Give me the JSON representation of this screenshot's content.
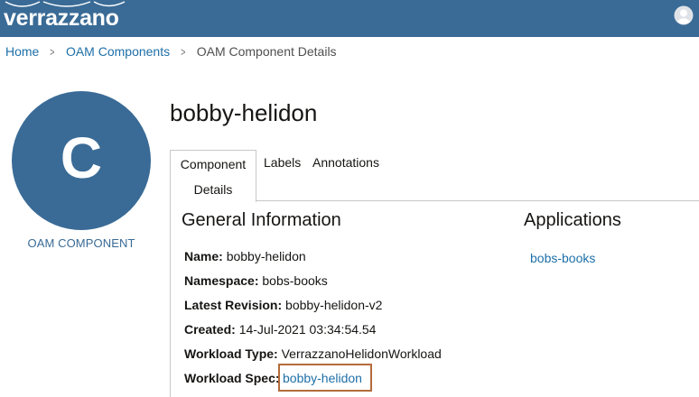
{
  "header": {
    "brand": "verrazzano",
    "brand_color": "#3a6b96",
    "user_icon": "user-avatar-icon"
  },
  "breadcrumb": {
    "items": [
      "Home",
      "OAM Components"
    ],
    "current": "OAM Component Details",
    "separator_icon": "chevron-right-icon"
  },
  "profile": {
    "initial": "C",
    "caption": "OAM COMPONENT"
  },
  "page": {
    "title": "bobby-helidon"
  },
  "tabs": {
    "items": [
      {
        "line1": "Component",
        "line2": "Details"
      },
      {
        "label": "Labels"
      },
      {
        "label": "Annotations"
      }
    ],
    "active_index": 0
  },
  "general_information": {
    "heading": "General Information",
    "fields": [
      {
        "label": "Name:",
        "value": "bobby-helidon"
      },
      {
        "label": "Namespace:",
        "value": "bobs-books"
      },
      {
        "label": "Latest Revision:",
        "value": "bobby-helidon-v2"
      },
      {
        "label": "Created:",
        "value": "14-Jul-2021 03:34:54.54"
      },
      {
        "label": "Workload Type:",
        "value": "VerrazzanoHelidonWorkload"
      },
      {
        "label": "Workload Spec:",
        "value": "bobby-helidon"
      }
    ]
  },
  "applications": {
    "heading": "Applications",
    "items": [
      "bobs-books"
    ]
  },
  "colors": {
    "link": "#1e6fa8",
    "highlight_box": "#b46b3a"
  }
}
